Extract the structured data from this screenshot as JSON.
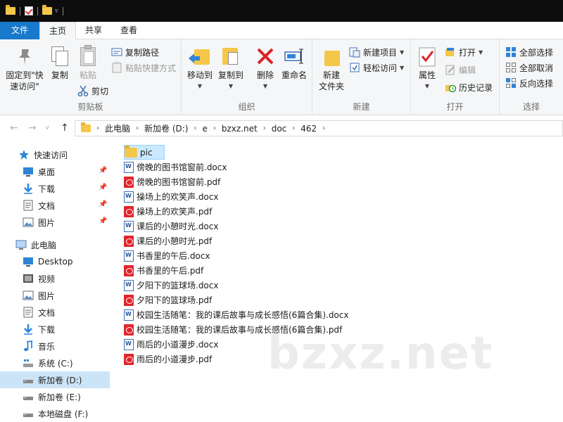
{
  "titlebar": {
    "icons": [
      "folder-icon",
      "properties-icon",
      "folder-icon",
      "dropdown-icon"
    ]
  },
  "tabs": [
    "文件",
    "主页",
    "共享",
    "查看"
  ],
  "ribbon": {
    "clipboard": {
      "label": "剪贴板",
      "pin_quick": "固定到\"快速访问\"",
      "copy": "复制",
      "paste": "粘贴",
      "copy_path": "复制路径",
      "paste_shortcut": "粘贴快捷方式",
      "cut": "剪切"
    },
    "organize": {
      "label": "组织",
      "move_to": "移动到",
      "copy_to": "复制到",
      "delete": "删除",
      "rename": "重命名"
    },
    "new": {
      "label": "新建",
      "new_folder": "新建\n文件夹",
      "new_item": "新建项目",
      "easy_access": "轻松访问"
    },
    "open": {
      "label": "打开",
      "properties": "属性",
      "open": "打开",
      "edit": "编辑",
      "history": "历史记录"
    },
    "select": {
      "label": "选择",
      "select_all": "全部选择",
      "select_none": "全部取消",
      "invert": "反向选择"
    }
  },
  "address": {
    "crumbs": [
      "此电脑",
      "新加卷 (D:)",
      "e",
      "bzxz.net",
      "doc",
      "462"
    ]
  },
  "nav": {
    "quick_access": "快速访问",
    "pinned": [
      "桌面",
      "下载",
      "文档",
      "图片"
    ],
    "this_pc": "此电脑",
    "pc_items": [
      "Desktop",
      "视频",
      "图片",
      "文档",
      "下载",
      "音乐",
      "系统 (C:)",
      "新加卷 (D:)",
      "新加卷 (E:)",
      "本地磁盘 (F:)"
    ]
  },
  "files": [
    {
      "name": "pic",
      "type": "folder"
    },
    {
      "name": "傍晚的图书馆窗前.docx",
      "type": "docx"
    },
    {
      "name": "傍晚的图书馆窗前.pdf",
      "type": "pdf"
    },
    {
      "name": "操场上的欢笑声.docx",
      "type": "docx"
    },
    {
      "name": "操场上的欢笑声.pdf",
      "type": "pdf"
    },
    {
      "name": "课后的小憩时光.docx",
      "type": "docx"
    },
    {
      "name": "课后的小憩时光.pdf",
      "type": "pdf"
    },
    {
      "name": "书香里的午后.docx",
      "type": "docx"
    },
    {
      "name": "书香里的午后.pdf",
      "type": "pdf"
    },
    {
      "name": "夕阳下的篮球场.docx",
      "type": "docx"
    },
    {
      "name": "夕阳下的篮球场.pdf",
      "type": "pdf"
    },
    {
      "name": "校园生活随笔：我的课后故事与成长感悟(6篇合集).docx",
      "type": "docx"
    },
    {
      "name": "校园生活随笔：我的课后故事与成长感悟(6篇合集).pdf",
      "type": "pdf"
    },
    {
      "name": "雨后的小道漫步.docx",
      "type": "docx"
    },
    {
      "name": "雨后的小道漫步.pdf",
      "type": "pdf"
    }
  ],
  "watermark": "bzxz.net",
  "colors": {
    "accent": "#1979ca",
    "selected": "#cce8ff",
    "nav_selected": "#cce4f7"
  }
}
